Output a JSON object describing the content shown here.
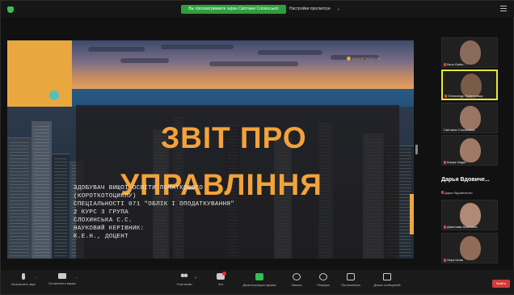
{
  "topbar": {
    "sharing_banner": "Вы просматриваете экран Світлани Слохінської",
    "view_options": "Настройки просмотра",
    "view_options_chevron": "chevron-down-icon"
  },
  "slide": {
    "logo_text": "ВІЛЬНЕ ПОЛІССЯ",
    "title_line1": "ЗВІТ ПРО",
    "title_line2": "УПРАВЛІННЯ",
    "info_lines": [
      "ЗДОБУВАЧ ВИЩОЇ ОСВІТИ ПОЧАТКОВОГО",
      "(КОРОТКОТОЦИКЛУ)",
      "СПЕЦІАЛЬНОСТІ 071 \"ОБЛІК І ОПОДАТКУВАННЯ\"",
      "2 КУРС 3 ГРУПА",
      "СЛОХИНСЬКА С.С.",
      "НАУКОВИЙ КЕРІВНИК:",
      "К.Е.Н., ДОЦЕНТ"
    ],
    "accent_color": "#f2a33a"
  },
  "participants": {
    "tiles": [
      {
        "name": "Ilona Gaidu...",
        "speaking": false,
        "muted": true,
        "face_color": "#8a6a5a"
      },
      {
        "name": "Олександр Приттонаця",
        "speaking": true,
        "muted": true,
        "face_color": "#7a5a48"
      },
      {
        "name": "Світлана Слохінська",
        "speaking": false,
        "muted": false,
        "face_color": "#9a7563"
      },
      {
        "name": "Кашук Надія",
        "speaking": false,
        "muted": true,
        "face_color": "#a07a64"
      }
    ],
    "big_name": "Дарья Вдовиче...",
    "big_name_sub": "Дарья Вдовиченко",
    "tiles_lower": [
      {
        "name": "Данилова Анастасія",
        "speaking": false,
        "muted": true,
        "face_color": "#b08a75"
      },
      {
        "name": "Лера Штак",
        "speaking": false,
        "muted": true,
        "face_color": "#8f6b58"
      }
    ],
    "scroll_chevron": "chevron-down-icon"
  },
  "toolbar": {
    "mute": "Выключить звук",
    "stop_video": "Остановить видео",
    "participants": "Участники",
    "participants_count": "9",
    "chat": "Чат",
    "chat_badge": "4",
    "share_screen": "Демонстрация экрана",
    "record": "Запись",
    "reactions": "Реакции",
    "apps": "Приложения",
    "notes": "Доска сообщений",
    "leave": "Выйти"
  }
}
